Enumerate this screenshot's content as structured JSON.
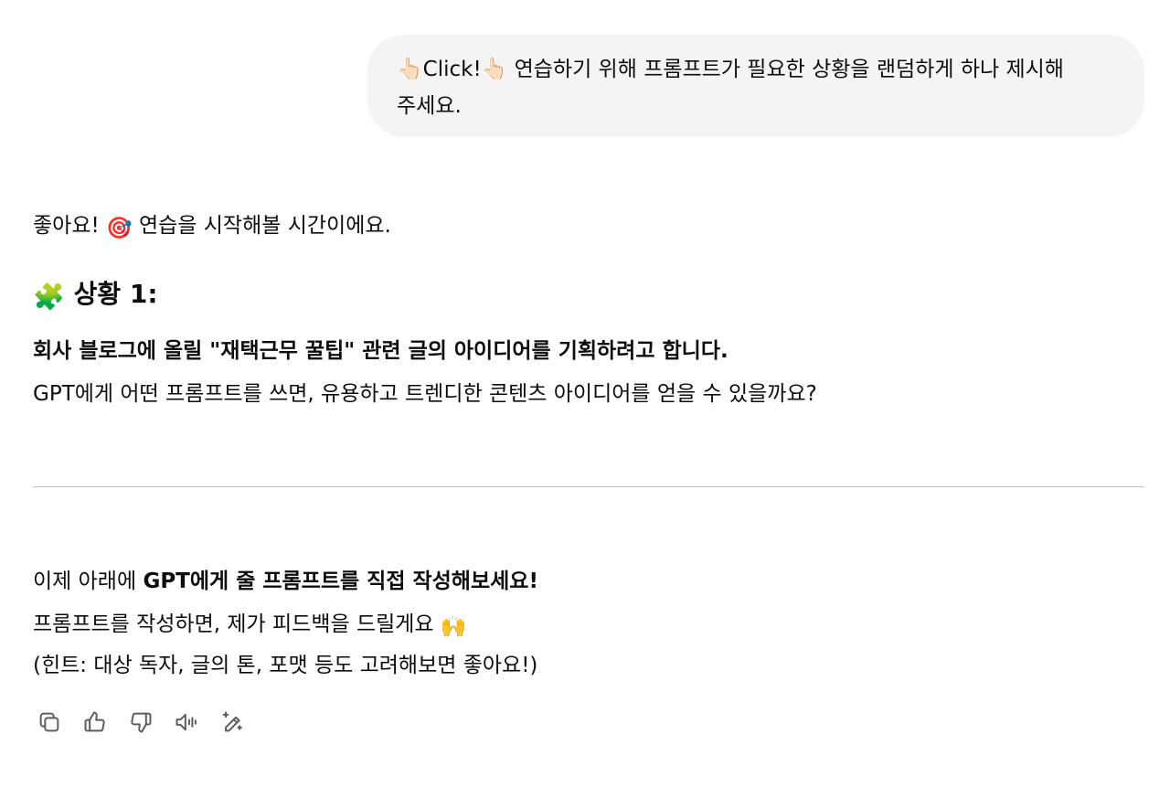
{
  "user_message": {
    "line1": "👆🏻Click!👆🏻 연습하기 위해 프롬프트가 필요한 상황을 랜덤하게 하나 제시해",
    "line2": "주세요."
  },
  "assistant": {
    "intro_text": "좋아요! ",
    "intro_emoji": "🎯",
    "intro_rest": " 연습을 시작해볼 시간이에요.",
    "heading_emoji": "🧩",
    "heading_text": "상황 1:",
    "situation_bold": "회사 블로그에 올릴 \"재택근무 꿀팁\" 관련 글의 아이디어를 기획하려고 합니다.",
    "situation_question": "GPT에게 어떤 프롬프트를 쓰면, 유용하고 트렌디한 콘텐츠 아이디어를 얻을 수 있을까요?",
    "cta_prefix": "이제 아래에 ",
    "cta_bold": "GPT에게 줄 프롬프트를 직접 작성해보세요!",
    "feedback_text": "프롬프트를 작성하면, 제가 피드백을 드릴게요 ",
    "feedback_emoji": "🙌",
    "hint_text": "(힌트: 대상 독자, 글의 톤, 포맷 등도 고려해보면 좋아요!)"
  },
  "actions": [
    {
      "name": "copy-icon"
    },
    {
      "name": "thumbs-up-icon"
    },
    {
      "name": "thumbs-down-icon"
    },
    {
      "name": "read-aloud-icon"
    },
    {
      "name": "edit-sparkle-icon"
    }
  ]
}
